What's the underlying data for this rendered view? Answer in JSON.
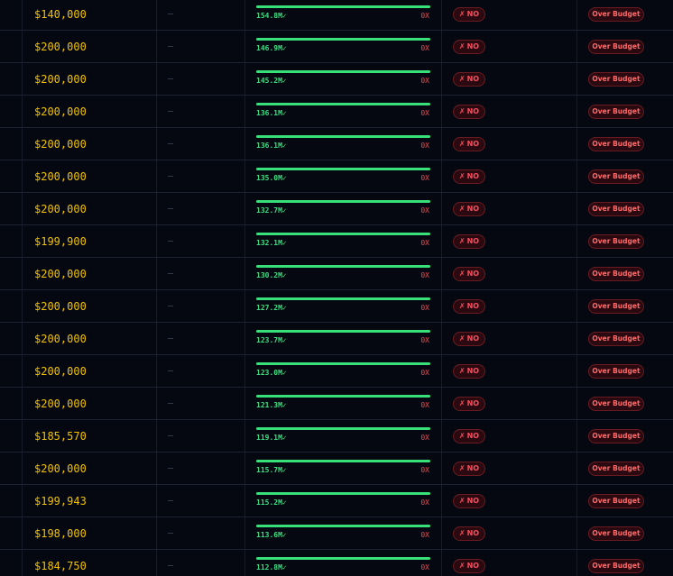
{
  "colors": {
    "background": "#050810",
    "budget_text": "#f2c200",
    "bar_fill": "#38e07a",
    "gross_text": "#3ddc84",
    "ratio_text": "#e0525a",
    "pill_text": "#ff4b5c",
    "pill_border": "#6a1b22"
  },
  "rows": [
    {
      "budget": "$140,000",
      "dash": "—",
      "gross": "154.8M✓",
      "bar_fraction": 1.0,
      "ratio": "0X",
      "roi": "NO",
      "status": "Over Budget"
    },
    {
      "budget": "$200,000",
      "dash": "—",
      "gross": "146.9M✓",
      "bar_fraction": 1.0,
      "ratio": "0X",
      "roi": "NO",
      "status": "Over Budget"
    },
    {
      "budget": "$200,000",
      "dash": "—",
      "gross": "145.2M✓",
      "bar_fraction": 1.0,
      "ratio": "0X",
      "roi": "NO",
      "status": "Over Budget"
    },
    {
      "budget": "$200,000",
      "dash": "—",
      "gross": "136.1M✓",
      "bar_fraction": 1.0,
      "ratio": "0X",
      "roi": "NO",
      "status": "Over Budget"
    },
    {
      "budget": "$200,000",
      "dash": "—",
      "gross": "136.1M✓",
      "bar_fraction": 1.0,
      "ratio": "0X",
      "roi": "NO",
      "status": "Over Budget"
    },
    {
      "budget": "$200,000",
      "dash": "—",
      "gross": "135.0M✓",
      "bar_fraction": 1.0,
      "ratio": "0X",
      "roi": "NO",
      "status": "Over Budget"
    },
    {
      "budget": "$200,000",
      "dash": "—",
      "gross": "132.7M✓",
      "bar_fraction": 1.0,
      "ratio": "0X",
      "roi": "NO",
      "status": "Over Budget"
    },
    {
      "budget": "$199,900",
      "dash": "—",
      "gross": "132.1M✓",
      "bar_fraction": 1.0,
      "ratio": "0X",
      "roi": "NO",
      "status": "Over Budget"
    },
    {
      "budget": "$200,000",
      "dash": "—",
      "gross": "130.2M✓",
      "bar_fraction": 1.0,
      "ratio": "0X",
      "roi": "NO",
      "status": "Over Budget"
    },
    {
      "budget": "$200,000",
      "dash": "—",
      "gross": "127.2M✓",
      "bar_fraction": 1.0,
      "ratio": "0X",
      "roi": "NO",
      "status": "Over Budget"
    },
    {
      "budget": "$200,000",
      "dash": "—",
      "gross": "123.7M✓",
      "bar_fraction": 1.0,
      "ratio": "0X",
      "roi": "NO",
      "status": "Over Budget"
    },
    {
      "budget": "$200,000",
      "dash": "—",
      "gross": "123.0M✓",
      "bar_fraction": 1.0,
      "ratio": "0X",
      "roi": "NO",
      "status": "Over Budget"
    },
    {
      "budget": "$200,000",
      "dash": "—",
      "gross": "121.3M✓",
      "bar_fraction": 1.0,
      "ratio": "0X",
      "roi": "NO",
      "status": "Over Budget"
    },
    {
      "budget": "$185,570",
      "dash": "—",
      "gross": "119.1M✓",
      "bar_fraction": 1.0,
      "ratio": "0X",
      "roi": "NO",
      "status": "Over Budget"
    },
    {
      "budget": "$200,000",
      "dash": "—",
      "gross": "115.7M✓",
      "bar_fraction": 1.0,
      "ratio": "0X",
      "roi": "NO",
      "status": "Over Budget"
    },
    {
      "budget": "$199,943",
      "dash": "—",
      "gross": "115.2M✓",
      "bar_fraction": 1.0,
      "ratio": "0X",
      "roi": "NO",
      "status": "Over Budget"
    },
    {
      "budget": "$198,000",
      "dash": "—",
      "gross": "113.6M✓",
      "bar_fraction": 1.0,
      "ratio": "0X",
      "roi": "NO",
      "status": "Over Budget"
    },
    {
      "budget": "$184,750",
      "dash": "—",
      "gross": "112.8M✓",
      "bar_fraction": 1.0,
      "ratio": "0X",
      "roi": "NO",
      "status": "Over Budget"
    }
  ],
  "icons": {
    "roi_no": "x-mark-icon"
  }
}
